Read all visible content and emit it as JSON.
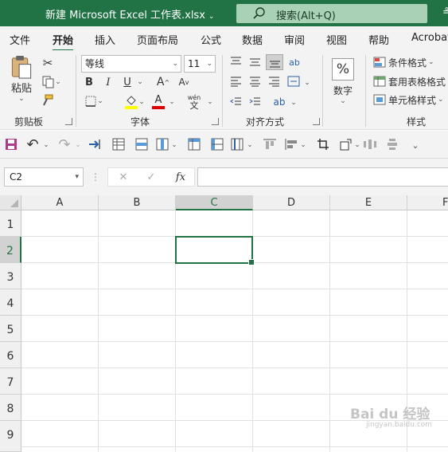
{
  "window": {
    "title": "新建 Microsoft Excel 工作表.xlsx",
    "title_caret": "⌄",
    "search_placeholder": "搜索(Alt+Q)",
    "title_extra": "≗"
  },
  "menu": {
    "tabs": [
      "文件",
      "开始",
      "插入",
      "页面布局",
      "公式",
      "数据",
      "审阅",
      "视图",
      "帮助",
      "Acrobat"
    ],
    "active": "开始"
  },
  "ribbon": {
    "clipboard": {
      "paste_label": "粘贴",
      "group_label": "剪贴板"
    },
    "font": {
      "name": "等线",
      "size": "11",
      "bold": "B",
      "italic": "I",
      "underline": "U",
      "grow": "A",
      "shrink": "A",
      "phonetic": "wén",
      "group_label": "字体"
    },
    "alignment": {
      "group_label": "对齐方式"
    },
    "number": {
      "symbol": "%",
      "label": "数字"
    },
    "styles": {
      "conditional": "条件格式",
      "table": "套用表格格式",
      "cell": "单元格样式",
      "group_label": "样式"
    },
    "colors": {
      "highlight": "#ffff00",
      "font_color": "#e00000",
      "accent": "#217346"
    }
  },
  "formula_bar": {
    "name_box": "C2",
    "cancel": "✕",
    "enter": "✓",
    "fx": "fx",
    "value": ""
  },
  "sheet": {
    "columns": [
      "A",
      "B",
      "C",
      "D",
      "E",
      "F"
    ],
    "rows": [
      "1",
      "2",
      "3",
      "4",
      "5",
      "6",
      "7",
      "8",
      "9"
    ],
    "selected_cell": "C2"
  },
  "watermark": {
    "line1": "Bai du 经验",
    "line2": "jingyan.baidu.com"
  }
}
